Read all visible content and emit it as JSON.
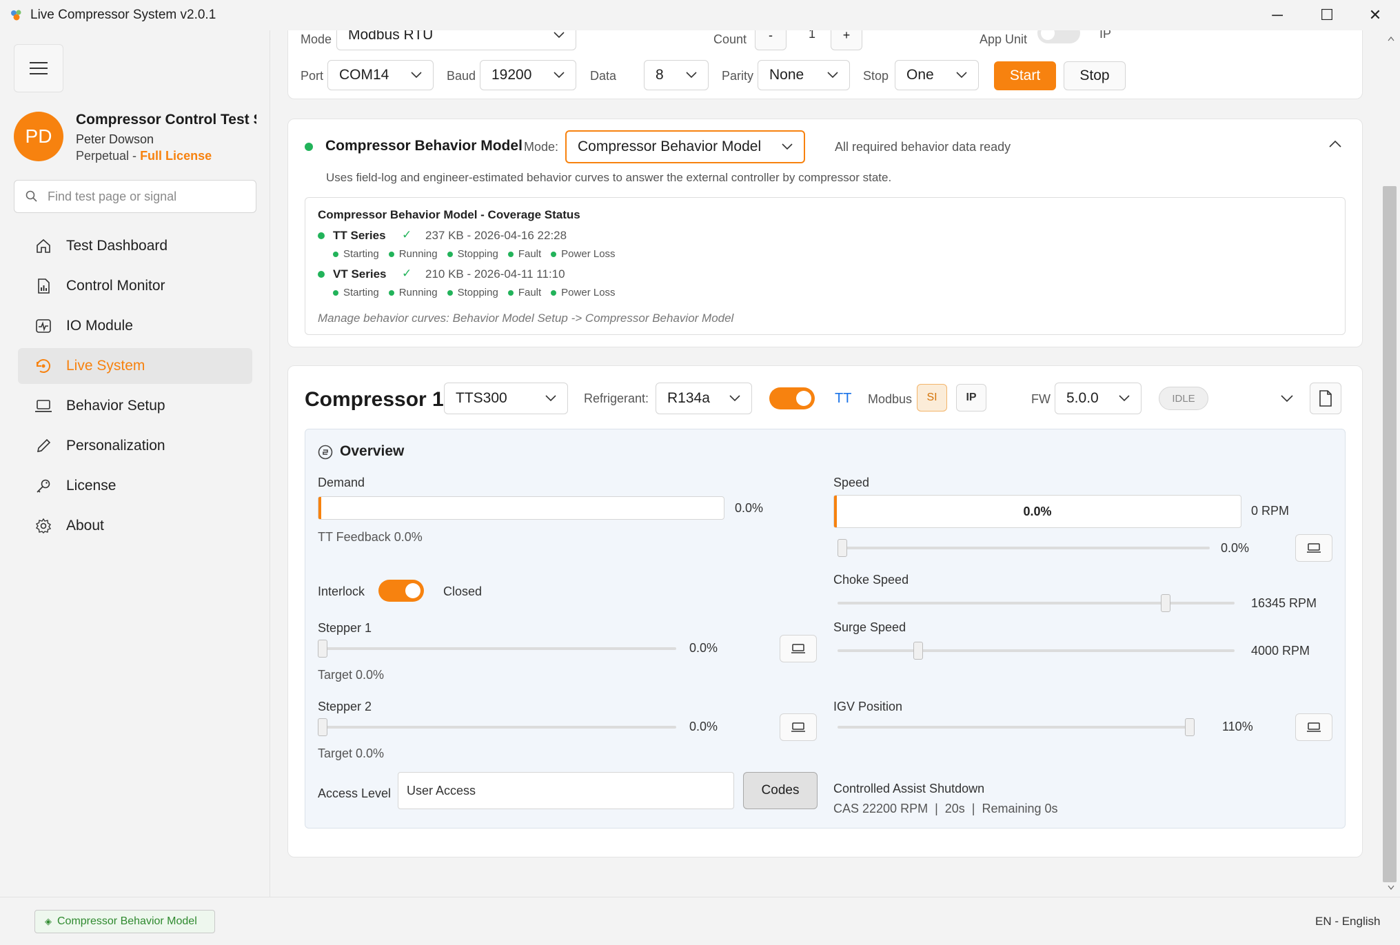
{
  "window": {
    "title": "Live Compressor System v2.0.1",
    "minimize_glyph": "─",
    "maximize_glyph": "☐",
    "close_glyph": "✕"
  },
  "sidebar": {
    "avatar_initials": "PD",
    "project_name": "Compressor Control Test Sim",
    "user_name": "Peter Dowson",
    "license_type": "Perpetual - ",
    "license_status": "Full License",
    "search_placeholder": "Find test page or signal",
    "items": [
      {
        "label": "Test Dashboard",
        "icon": "home-icon"
      },
      {
        "label": "Control Monitor",
        "icon": "document-chart-icon"
      },
      {
        "label": "IO Module",
        "icon": "pulse-icon"
      },
      {
        "label": "Live System",
        "icon": "refresh-icon",
        "active": true
      },
      {
        "label": "Behavior Setup",
        "icon": "laptop-icon"
      },
      {
        "label": "Personalization",
        "icon": "pen-icon"
      },
      {
        "label": "License",
        "icon": "key-icon"
      },
      {
        "label": "About",
        "icon": "gear-icon"
      }
    ]
  },
  "connection": {
    "mode_label": "Mode",
    "mode_value": "Modbus RTU",
    "count_label": "Count",
    "count_minus": "-",
    "count_value": "1",
    "count_plus": "+",
    "app_unit_label": "App Unit",
    "app_unit_right": "IP",
    "port_label": "Port",
    "port_value": "COM14",
    "baud_label": "Baud",
    "baud_value": "19200",
    "data_label": "Data",
    "data_value": "8",
    "parity_label": "Parity",
    "parity_value": "None",
    "stop_label": "Stop",
    "stop_value": "One",
    "start_button": "Start",
    "stop_button": "Stop"
  },
  "behavior_model": {
    "title": "Compressor Behavior Model",
    "mode_label": "Mode:",
    "mode_value": "Compressor Behavior Model",
    "status_text": "All required behavior data ready",
    "description": "Uses field-log and engineer-estimated behavior curves to answer the external controller by compressor state.",
    "coverage_title": "Compressor Behavior Model - Coverage Status",
    "series": [
      {
        "name": "TT Series",
        "check": "✓",
        "info": "237 KB - 2026-04-16 22:28",
        "states": [
          "Starting",
          "Running",
          "Stopping",
          "Fault",
          "Power Loss"
        ]
      },
      {
        "name": "VT Series",
        "check": "✓",
        "info": "210 KB - 2026-04-11 11:10",
        "states": [
          "Starting",
          "Running",
          "Stopping",
          "Fault",
          "Power Loss"
        ]
      }
    ],
    "manage_hint": "Manage behavior curves: Behavior Model Setup -> Compressor Behavior Model"
  },
  "compressor": {
    "title": "Compressor 1",
    "model_value": "TTS300",
    "refrigerant_label": "Refrigerant:",
    "refrigerant_value": "R134a",
    "type_label": "TT",
    "modbus_label": "Modbus",
    "si_button": "SI",
    "ip_button": "IP",
    "fw_label": "FW",
    "fw_value": "5.0.0",
    "state_badge": "IDLE",
    "overview_title": "Overview",
    "demand_label": "Demand",
    "demand_value": "0.0%",
    "tt_feedback": "TT Feedback 0.0%",
    "speed_label": "Speed",
    "speed_bar_value": "0.0%",
    "speed_rpm": "0 RPM",
    "speed_slider_value": "0.0%",
    "interlock_label": "Interlock",
    "interlock_state": "Closed",
    "choke_label": "Choke Speed",
    "choke_value": "16345 RPM",
    "surge_label": "Surge Speed",
    "surge_value": "4000 RPM",
    "stepper1_label": "Stepper 1",
    "stepper1_value": "0.0%",
    "stepper1_target": "Target 0.0%",
    "stepper2_label": "Stepper 2",
    "stepper2_value": "0.0%",
    "stepper2_target": "Target 0.0%",
    "igv_label": "IGV Position",
    "igv_value": "110%",
    "access_label": "Access Level",
    "access_value": "User Access",
    "codes_button": "Codes",
    "cas_title": "Controlled Assist Shutdown",
    "cas_detail": "CAS 22200 RPM  |  20s  |  Remaining 0s"
  },
  "statusbar": {
    "model_chip": "Compressor Behavior Model",
    "chip_glyph": "◈",
    "language": "EN - English"
  },
  "colors": {
    "accent": "#f7820f",
    "ready_green": "#22b35a",
    "link_blue": "#1a73e8"
  }
}
